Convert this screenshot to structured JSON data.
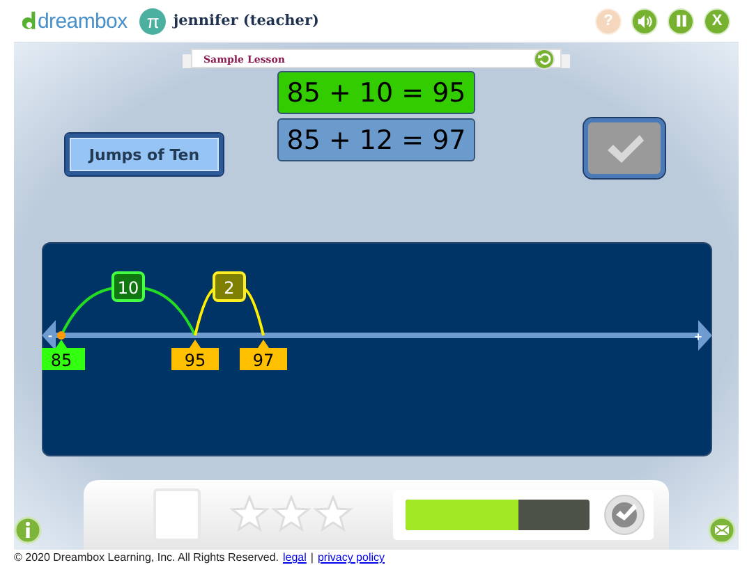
{
  "header": {
    "logo": "dreambox",
    "user_badge": "π",
    "user": "jennifer (teacher)",
    "buttons": [
      {
        "kind": "help",
        "label": "?",
        "disabled": true
      },
      {
        "kind": "sound",
        "disabled": false
      },
      {
        "kind": "pause",
        "disabled": false
      },
      {
        "kind": "close",
        "label": "X",
        "disabled": false
      }
    ]
  },
  "lesson": {
    "title": "Sample Lesson"
  },
  "strategy_button": "Jumps of Ten",
  "equations": [
    {
      "text": "85 + 10 = 95",
      "kind": "done"
    },
    {
      "text": "85 + 12 = 97",
      "kind": "current"
    }
  ],
  "check_button": {
    "disabled": true
  },
  "number_line": {
    "minus": "-",
    "plus": "+",
    "markers": [
      {
        "label": "85",
        "kind": "start"
      },
      {
        "label": "95",
        "kind": "point"
      },
      {
        "label": "97",
        "kind": "point"
      }
    ],
    "jumps": [
      {
        "label": "10",
        "kind": "ten"
      },
      {
        "label": "2",
        "kind": "one"
      }
    ]
  },
  "progress": {
    "stars": 0,
    "level": 0.61
  },
  "footer": {
    "copyright": "© 2020 Dreambox Learning, Inc. All Rights Reserved.",
    "links": [
      "legal",
      "privacy policy"
    ],
    "separator": "|"
  }
}
